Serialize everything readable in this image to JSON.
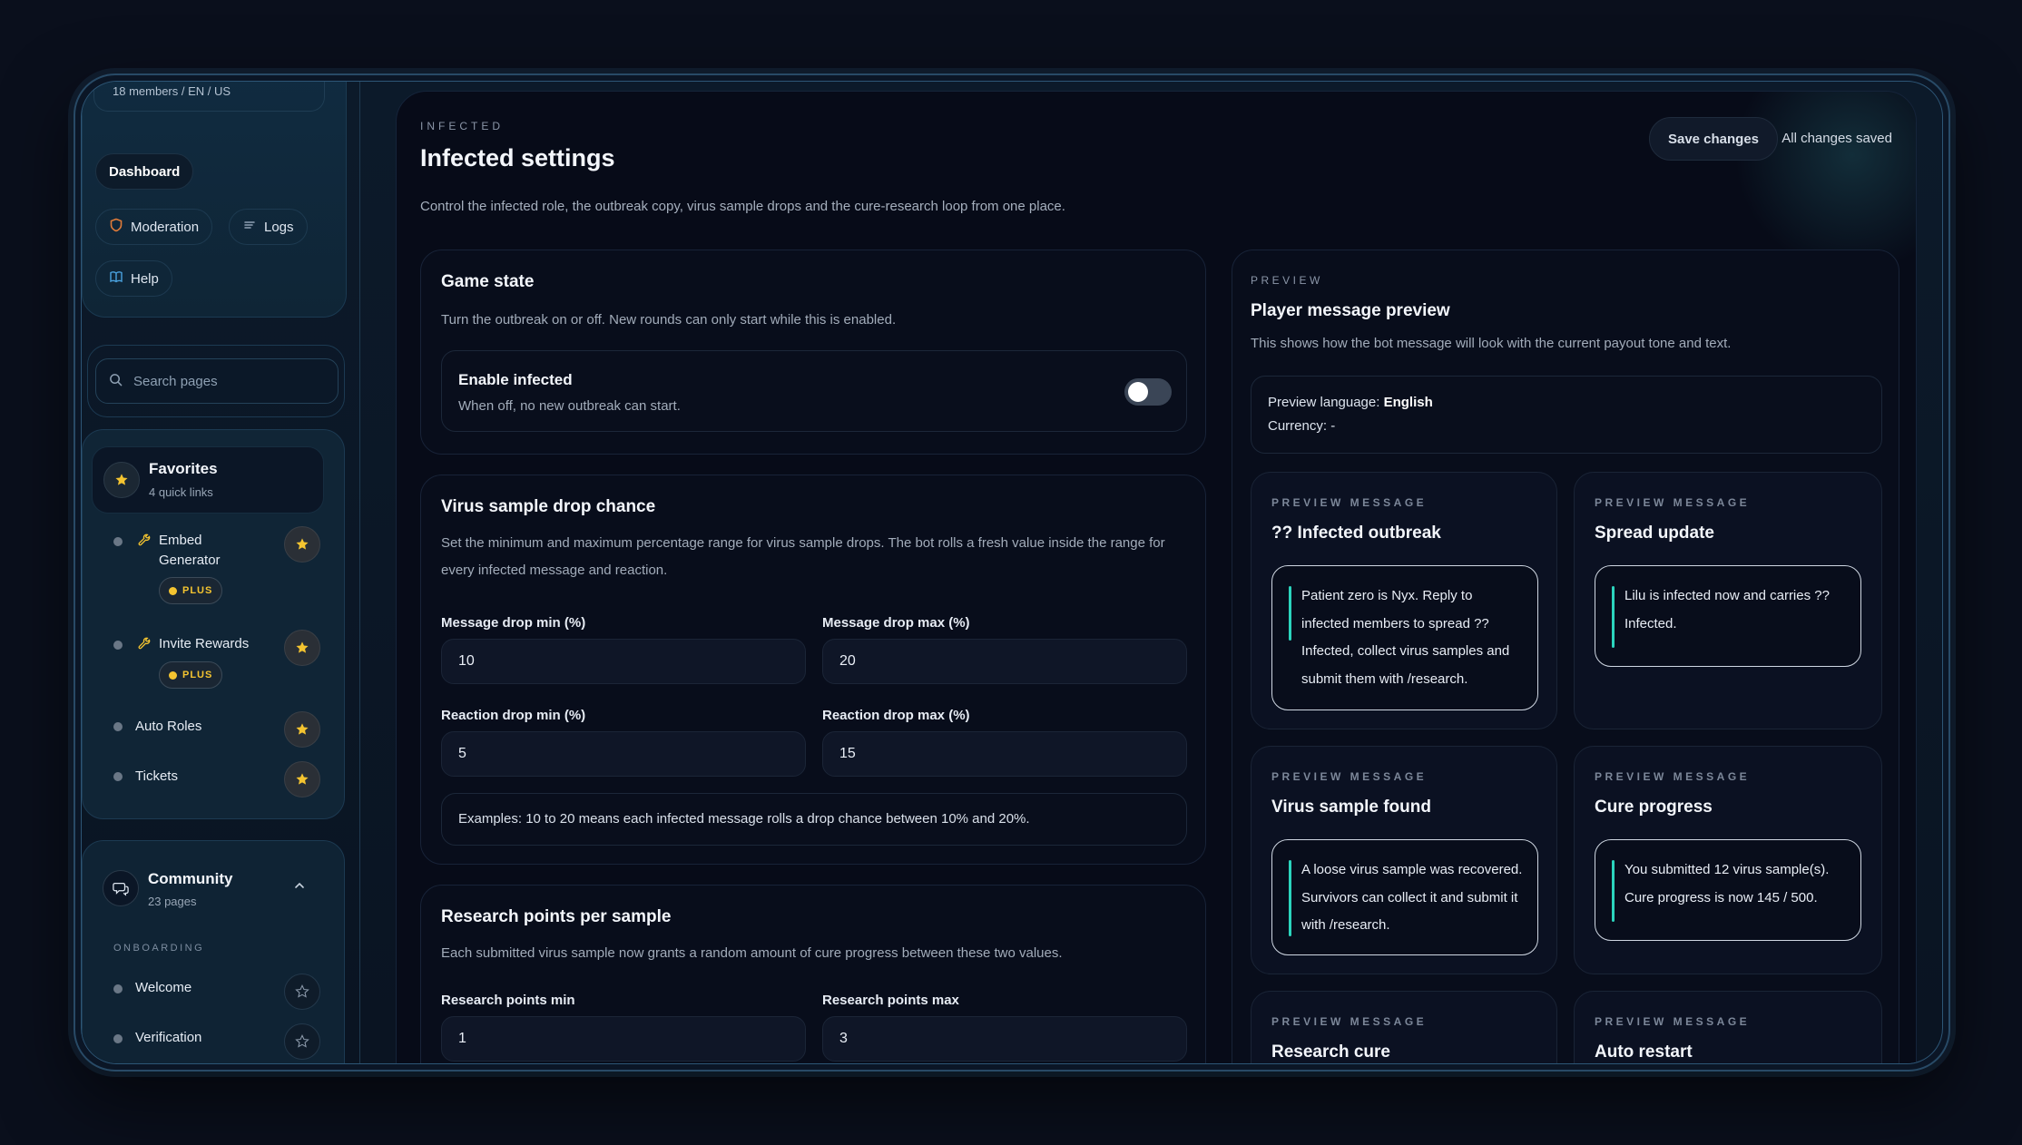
{
  "sidebar": {
    "server_meta": "18 members / EN / US",
    "nav": {
      "dashboard": "Dashboard",
      "moderation": "Moderation",
      "logs": "Logs",
      "help": "Help"
    },
    "search_placeholder": "Search pages",
    "favorites": {
      "title": "Favorites",
      "subtitle": "4 quick links",
      "items": [
        {
          "label": "Embed Generator",
          "badge": "PLUS",
          "icon": "wrench-icon",
          "starred": true
        },
        {
          "label": "Invite Rewards",
          "badge": "PLUS",
          "icon": "wrench-icon",
          "starred": true
        },
        {
          "label": "Auto Roles",
          "badge": "",
          "starred": true
        },
        {
          "label": "Tickets",
          "badge": "",
          "starred": true
        }
      ]
    },
    "community": {
      "title": "Community",
      "subtitle": "23 pages",
      "section": "ONBOARDING",
      "items": [
        {
          "label": "Welcome",
          "starred": false
        },
        {
          "label": "Verification",
          "starred": false
        }
      ]
    }
  },
  "header": {
    "eyebrow": "INFECTED",
    "title": "Infected settings",
    "description": "Control the infected role, the outbreak copy, virus sample drops and the cure-research loop from one place.",
    "save_button": "Save changes",
    "status": "All changes saved"
  },
  "game_state": {
    "title": "Game state",
    "description": "Turn the outbreak on or off. New rounds can only start while this is enabled.",
    "toggle_title": "Enable infected",
    "toggle_desc": "When off, no new outbreak can start.",
    "enabled": false
  },
  "drop_chance": {
    "title": "Virus sample drop chance",
    "description": "Set the minimum and maximum percentage range for virus sample drops. The bot rolls a fresh value inside the range for every infected message and reaction.",
    "fields": {
      "msg_min_label": "Message drop min (%)",
      "msg_min": "10",
      "msg_max_label": "Message drop max (%)",
      "msg_max": "20",
      "react_min_label": "Reaction drop min (%)",
      "react_min": "5",
      "react_max_label": "Reaction drop max (%)",
      "react_max": "15"
    },
    "example": "Examples: 10 to 20 means each infected message rolls a drop chance between 10% and 20%."
  },
  "research": {
    "title": "Research points per sample",
    "description": "Each submitted virus sample now grants a random amount of cure progress between these two values.",
    "min_label": "Research points min",
    "min": "1",
    "max_label": "Research points max",
    "max": "3"
  },
  "preview": {
    "eyebrow": "PREVIEW",
    "title": "Player message preview",
    "description": "This shows how the bot message will look with the current payout tone and text.",
    "language_label": "Preview language:",
    "language": "English",
    "currency_label": "Currency:",
    "currency": "-",
    "message_eyebrow": "PREVIEW MESSAGE",
    "messages": [
      {
        "title": "?? Infected outbreak",
        "body": "Patient zero is Nyx. Reply to infected members to spread ?? Infected, collect virus samples and submit them with /research."
      },
      {
        "title": "Spread update",
        "body": "Lilu is infected now and carries ?? Infected."
      },
      {
        "title": "Virus sample found",
        "body": "A loose virus sample was recovered. Survivors can collect it and submit it with /research."
      },
      {
        "title": "Cure progress",
        "body": "You submitted 12 virus sample(s). Cure progress is now 145 / 500."
      },
      {
        "title": "Research cure",
        "body": ""
      },
      {
        "title": "Auto restart",
        "body": ""
      }
    ]
  },
  "colors": {
    "accent": "#2bd4bd",
    "star": "#f4c430",
    "background": "#070b18"
  }
}
